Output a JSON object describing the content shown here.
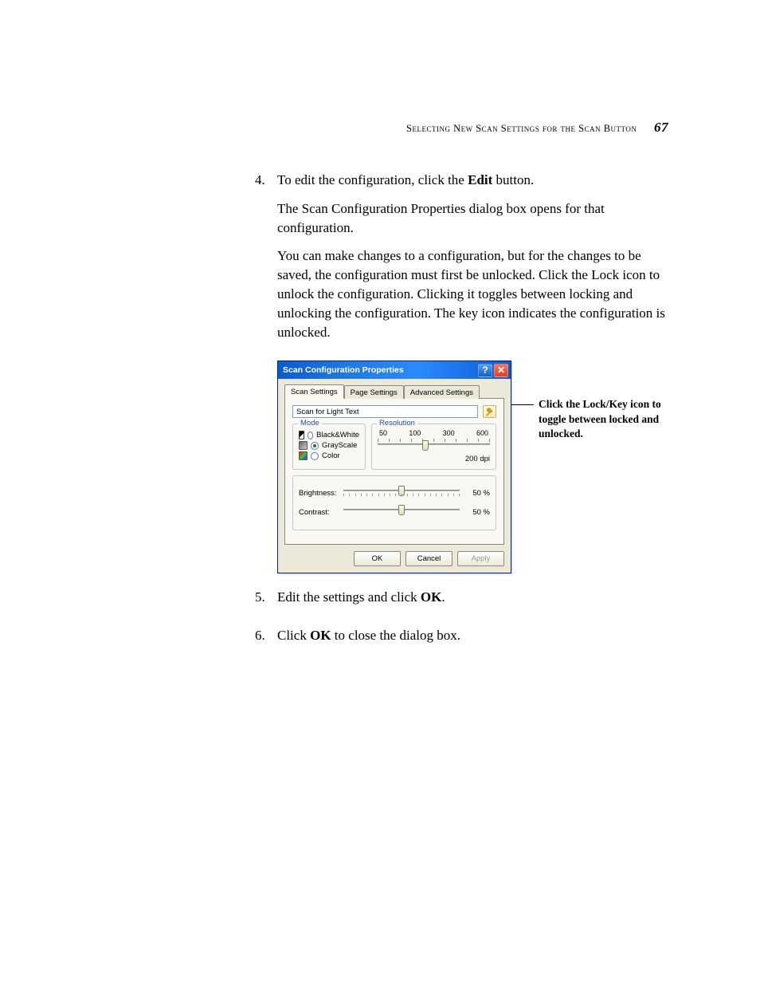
{
  "header": {
    "running_title": "Selecting New Scan Settings for the Scan Button",
    "page_number": "67"
  },
  "steps": {
    "s4": {
      "num": "4.",
      "line1_pre": "To edit the configuration, click the ",
      "line1_bold": "Edit",
      "line1_post": " button.",
      "p2": "The Scan Configuration Properties dialog box opens for that configuration.",
      "p3": "You can make changes to a configuration, but for the changes to be saved, the configuration must first be unlocked. Click the Lock icon to unlock the configuration. Clicking it toggles between locking and unlocking the configuration. The key icon indicates the configuration is unlocked."
    },
    "s5": {
      "num": "5.",
      "pre": "Edit the settings and click ",
      "bold": "OK",
      "post": "."
    },
    "s6": {
      "num": "6.",
      "pre": "Click ",
      "bold": "OK",
      "post": " to close the dialog box."
    }
  },
  "dialog": {
    "title": "Scan Configuration Properties",
    "tabs": {
      "scan": "Scan Settings",
      "page": "Page Settings",
      "advanced": "Advanced Settings"
    },
    "name_value": "Scan for Light Text",
    "mode": {
      "legend": "Mode",
      "bw": "Black&White",
      "gray": "GrayScale",
      "color": "Color"
    },
    "resolution": {
      "legend": "Resolution",
      "t50": "50",
      "t100": "100",
      "t300": "300",
      "t600": "600",
      "value_label": "200 dpi"
    },
    "brightness": {
      "label": "Brightness:",
      "value": "50 %"
    },
    "contrast": {
      "label": "Contrast:",
      "value": "50 %"
    },
    "buttons": {
      "ok": "OK",
      "cancel": "Cancel",
      "apply": "Apply"
    }
  },
  "callout": "Click the Lock/Key icon to toggle between locked and unlocked."
}
